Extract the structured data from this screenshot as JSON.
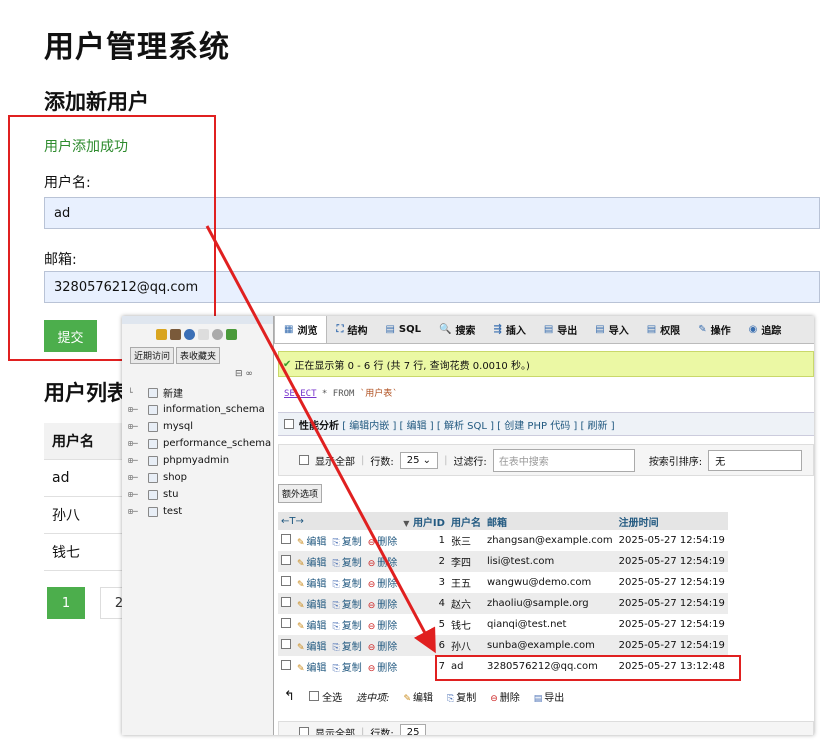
{
  "page": {
    "title": "用户管理系统",
    "add_heading": "添加新用户",
    "success_msg": "用户添加成功",
    "username_label": "用户名:",
    "username_value": "ad",
    "email_label": "邮箱:",
    "email_value": "3280576212@qq.com",
    "submit_label": "提交",
    "list_heading": "用户列表",
    "list_header": "用户名",
    "list_rows": [
      "ad",
      "孙八",
      "钱七"
    ],
    "pagination": [
      "1",
      "2"
    ]
  },
  "pma": {
    "side_tabs": [
      "近期访问",
      "表收藏夹"
    ],
    "side_tools": "⊟ ∞",
    "databases": [
      "新建",
      "information_schema",
      "mysql",
      "performance_schema",
      "phpmyadmin",
      "shop",
      "stu",
      "test"
    ],
    "tabs": [
      "浏览",
      "结构",
      "SQL",
      "搜索",
      "插入",
      "导出",
      "导入",
      "权限",
      "操作",
      "追踪"
    ],
    "tab_icons": [
      "▦",
      "⛶",
      "▤",
      "🔍",
      "⇶",
      "▤",
      "▤",
      "▤",
      "✎",
      "◉"
    ],
    "message": "正在显示第 0 - 6 行 (共 7 行, 查询花费 0.0010 秒。)",
    "sql_select": "SELECT",
    "sql_star": " * FROM ",
    "sql_table": "`用户表`",
    "profiling": "性能分析",
    "profiling_links": "[ 编辑内嵌 ] [ 编辑 ] [ 解析 SQL ] [ 创建 PHP 代码 ] [ 刷新 ]",
    "show_all": "显示全部",
    "rows_label": "行数:",
    "rows_value": "25",
    "filter_label": "过滤行:",
    "filter_placeholder": "在表中搜索",
    "sort_label": "按索引排序:",
    "sort_value": "无",
    "extra_options": "额外选项",
    "col_headers": [
      "用户ID",
      "用户名",
      "邮箱",
      "注册时间"
    ],
    "actions": [
      "编辑",
      "复制",
      "删除"
    ],
    "rows": [
      {
        "id": "1",
        "name": "张三",
        "email": "zhangsan@example.com",
        "time": "2025-05-27 12:54:19"
      },
      {
        "id": "2",
        "name": "李四",
        "email": "lisi@test.com",
        "time": "2025-05-27 12:54:19"
      },
      {
        "id": "3",
        "name": "王五",
        "email": "wangwu@demo.com",
        "time": "2025-05-27 12:54:19"
      },
      {
        "id": "4",
        "name": "赵六",
        "email": "zhaoliu@sample.org",
        "time": "2025-05-27 12:54:19"
      },
      {
        "id": "5",
        "name": "钱七",
        "email": "qianqi@test.net",
        "time": "2025-05-27 12:54:19"
      },
      {
        "id": "6",
        "name": "孙八",
        "email": "sunba@example.com",
        "time": "2025-05-27 12:54:19"
      },
      {
        "id": "7",
        "name": "ad",
        "email": "3280576212@qq.com",
        "time": "2025-05-27 13:12:48"
      }
    ],
    "select_all": "全选",
    "selected_label": "选中项:",
    "bulk_actions": [
      "编辑",
      "复制",
      "删除",
      "导出"
    ]
  },
  "colors": {
    "annotation": "#e02020",
    "success": "#2e8b2e",
    "button": "#4cae4c"
  }
}
